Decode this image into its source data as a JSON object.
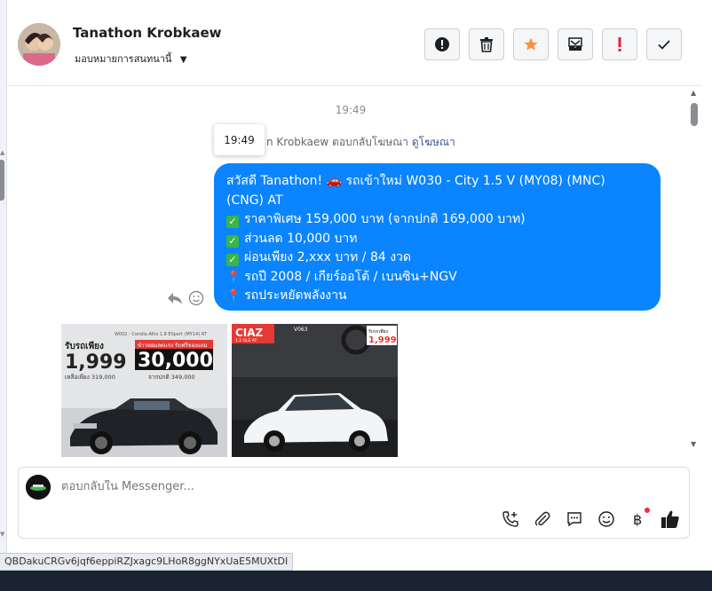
{
  "header": {
    "user_name": "Tanathon Krobkaew",
    "assign_label": "มอบหมายการสนทนานี้",
    "actions": [
      {
        "name": "mark-spam",
        "icon": "exclamation-circle-icon"
      },
      {
        "name": "delete",
        "icon": "trash-icon"
      },
      {
        "name": "star",
        "icon": "star-icon",
        "color": "#f7923b"
      },
      {
        "name": "mark-unread",
        "icon": "envelope-icon"
      },
      {
        "name": "follow-up",
        "icon": "exclamation-icon",
        "color": "#e41e3f"
      },
      {
        "name": "mark-done",
        "icon": "check-icon"
      }
    ]
  },
  "chat": {
    "timestamp": "19:49",
    "tooltip_time": "19:49",
    "reply_note": "n Krobkaew ตอบกลับโฆษณา",
    "reply_link": "ดูโฆษณา",
    "message": {
      "line1": "สวัสดี Tanathon! 🚗 รถเข้าใหม่ W030 - City 1.5 V (MY08) (MNC)",
      "line2": "(CNG) AT",
      "line3": "ราคาพิเศษ 159,000 บาท (จากปกติ 169,000 บาท)",
      "line4": "ส่วนลด 10,000 บาท",
      "line5": "ผ่อนเพียง 2,xxx บาท / 84 งวด",
      "line6": "รถปี 2008 / เกียร์ออโต้ / เบนซิน+NGV",
      "line7": "รถประหยัดพลังงาน"
    },
    "card1": {
      "top_text": "W002 - Corolla Altis 1.8 ESport (MY14) AT",
      "price_label": "รับรถเพียง",
      "price": "1,999",
      "sale_label": "ข้าวหอมลดแรง รับฟรีของแถม",
      "sale": "30,000",
      "remaining": "เหลือเพียง 319,000",
      "normal": "จากปกติ 349,000"
    },
    "card2": {
      "badge": "CIAZ",
      "badge_sub": "1.2 GLE AT",
      "code": "V063",
      "price_label": "รับรถเพียง",
      "price": "1,999"
    }
  },
  "composer": {
    "placeholder": "ตอบกลับใน Messenger..."
  },
  "status_url": "QBDakuCRGv6jqf6eppiRZJxagc9LHoR8ggNYxUaE5MUXtDI",
  "colors": {
    "bubble": "#0a84ff",
    "link": "#385898",
    "accent_blue": "#1877f2"
  }
}
